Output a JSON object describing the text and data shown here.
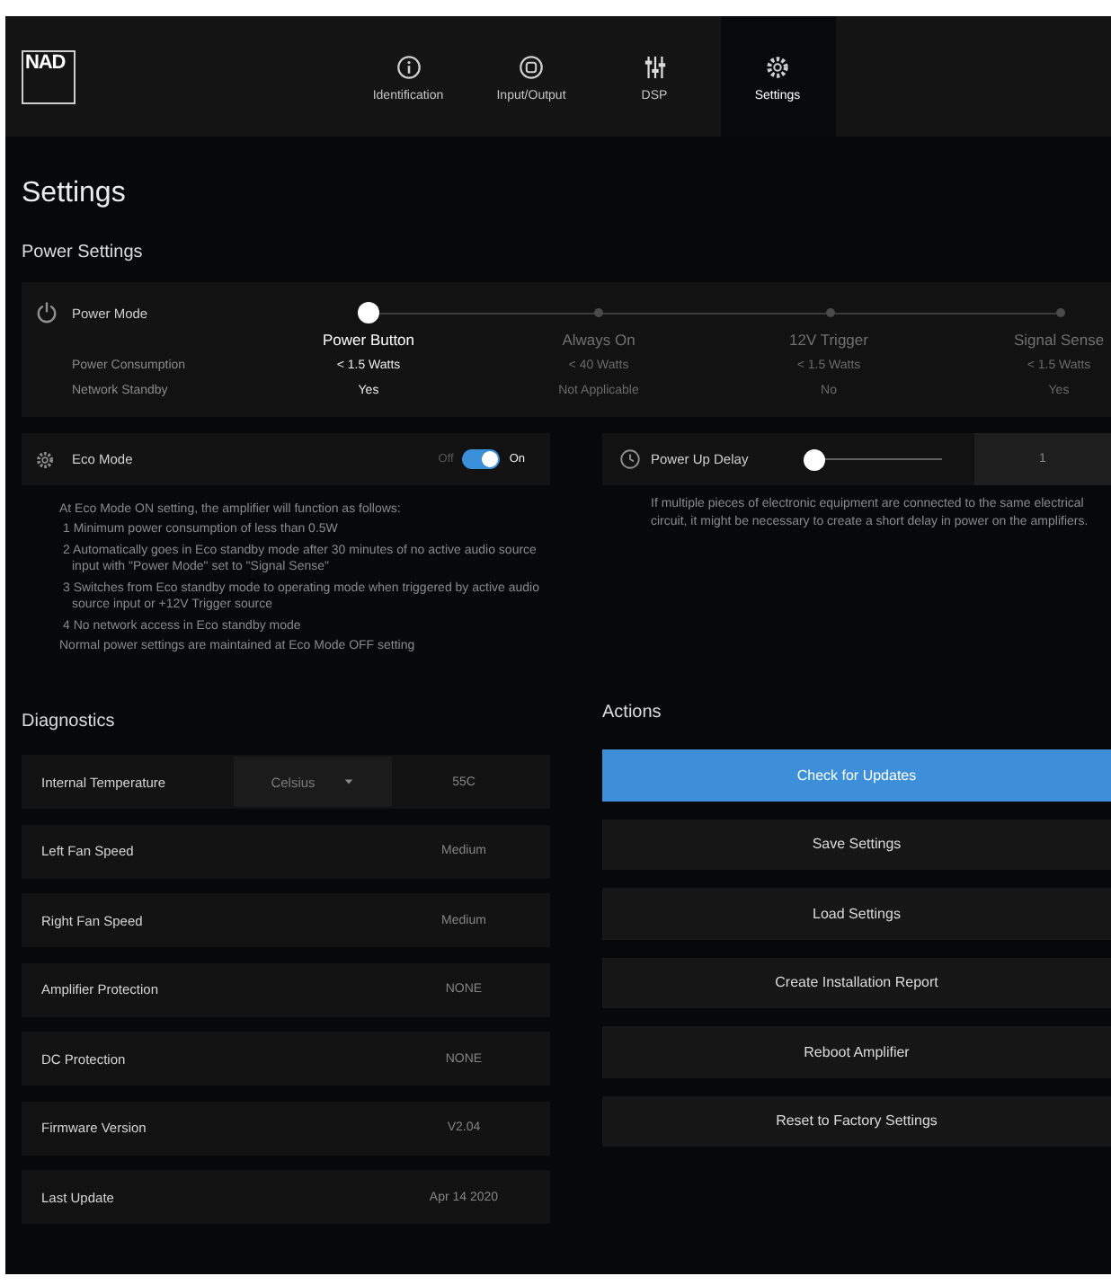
{
  "header": {
    "logo": "NAD",
    "tabs": [
      {
        "label": "Identification",
        "kind": "identification",
        "selected": false
      },
      {
        "label": "Input/Output",
        "kind": "inputoutput",
        "selected": false
      },
      {
        "label": "DSP",
        "kind": "dsp",
        "selected": false
      },
      {
        "label": "Settings",
        "kind": "settings",
        "selected": true
      }
    ]
  },
  "page": {
    "title": "Settings"
  },
  "power_settings": {
    "heading": "Power Settings",
    "power_mode": {
      "label": "Power Mode",
      "consumption_label": "Power Consumption",
      "standby_label": "Network Standby",
      "options": [
        {
          "label": "Power Button",
          "selected": true,
          "consumption": "< 1.5 Watts",
          "network_standby": "Yes"
        },
        {
          "label": "Always On",
          "selected": false,
          "consumption": "< 40 Watts",
          "network_standby": "Not Applicable"
        },
        {
          "label": "12V Trigger",
          "selected": false,
          "consumption": "< 1.5 Watts",
          "network_standby": "No"
        },
        {
          "label": "Signal Sense",
          "selected": false,
          "consumption": "< 1.5 Watts",
          "network_standby": "Yes"
        }
      ]
    }
  },
  "eco_mode": {
    "label": "Eco Mode",
    "off_label": "Off",
    "on_label": "On",
    "on": true,
    "intro": "At Eco Mode ON setting, the amplifier will function as follows:",
    "items": [
      "1 Minimum power consumption of less than 0.5W",
      "2 Automatically goes in Eco standby mode after 30 minutes of no active audio source input with \"Power Mode\" set to \"Signal Sense\"",
      "3 Switches from Eco standby mode to operating mode when triggered by active audio source input or +12V Trigger source",
      "4 No network access in Eco standby mode"
    ],
    "note": "Normal power settings are maintained at Eco Mode OFF setting"
  },
  "power_up_delay": {
    "label": "Power Up Delay",
    "level": 0,
    "value": "1",
    "description": "If multiple pieces of electronic equipment are connected to the same electrical circuit, it might be necessary to create a short delay in power on the amplifiers."
  },
  "diagnostics": {
    "heading": "Diagnostics",
    "rows": [
      {
        "label": "Internal Temperature",
        "kind": "select",
        "unit": "Celsius",
        "value": "55C"
      },
      {
        "label": "Left Fan Speed",
        "kind": "text",
        "value": "Medium"
      },
      {
        "label": "Right Fan Speed",
        "kind": "text",
        "value": "Medium"
      },
      {
        "label": "Amplifier Protection",
        "kind": "text",
        "value": "NONE"
      },
      {
        "label": "DC Protection",
        "kind": "text",
        "value": "NONE"
      },
      {
        "label": "Firmware Version",
        "kind": "text",
        "value": "V2.04"
      },
      {
        "label": "Last Update",
        "kind": "text",
        "value": "Apr 14 2020"
      }
    ]
  },
  "actions": {
    "heading": "Actions",
    "buttons": [
      {
        "label": "Check for Updates",
        "kind": "primary"
      },
      {
        "label": "Save Settings",
        "kind": "default"
      },
      {
        "label": "Load Settings",
        "kind": "default"
      },
      {
        "label": "Create Installation Report",
        "kind": "default"
      },
      {
        "label": "Reboot Amplifier",
        "kind": "default"
      },
      {
        "label": "Reset to Factory Settings",
        "kind": "default"
      }
    ]
  }
}
